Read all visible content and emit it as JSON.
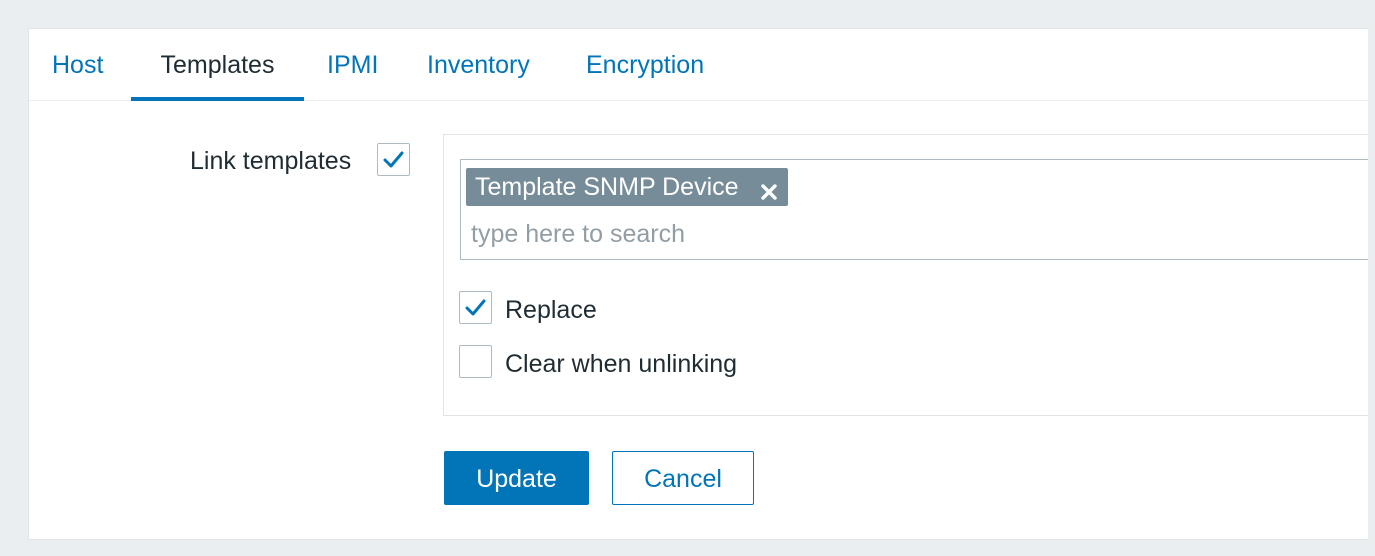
{
  "tabs": [
    {
      "label": "Host",
      "active": false
    },
    {
      "label": "Templates",
      "active": true
    },
    {
      "label": "IPMI",
      "active": false
    },
    {
      "label": "Inventory",
      "active": false
    },
    {
      "label": "Encryption",
      "active": false
    }
  ],
  "link_templates": {
    "label": "Link templates",
    "checked": true,
    "selected": [
      {
        "name": "Template SNMP Device"
      }
    ],
    "search_placeholder": "type here to search"
  },
  "options": {
    "replace": {
      "label": "Replace",
      "checked": true
    },
    "clear_when_unlinking": {
      "label": "Clear when unlinking",
      "checked": false
    }
  },
  "buttons": {
    "update": "Update",
    "cancel": "Cancel"
  },
  "colors": {
    "accent": "#0275b8",
    "chip": "#768d99",
    "background": "#ebeef0"
  },
  "icons": {
    "checkmark": "check-icon",
    "remove": "close-icon"
  }
}
